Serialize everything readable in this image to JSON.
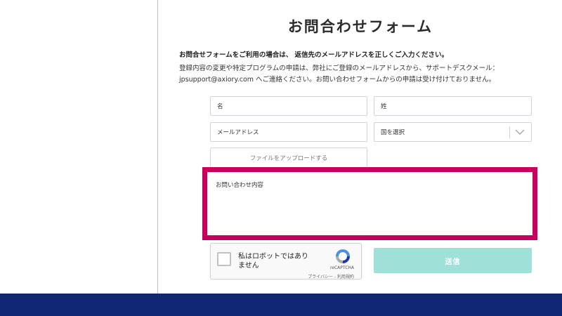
{
  "form": {
    "title": "お問合わせフォーム",
    "notice": "お問合せフォームをご利用の場合は、 返信先のメールアドレスを正しくご入力ください。",
    "description": "登録内容の変更や特定プログラムの申請は、弊社にご登録のメールアドレスから、サポートデスクメール：jpsupport@axiory.com へご連絡ください。お問い合わせフォームからの申請は受け付けておりません。",
    "first_name_placeholder": "名",
    "last_name_placeholder": "姓",
    "email_placeholder": "メールアドレス",
    "country_placeholder": "国を選択",
    "upload_label": "ファイルをアップロードする",
    "message_placeholder": "お問い合わせ内容",
    "submit_label": "送信"
  },
  "captcha": {
    "label": "私はロボットではありません",
    "brand": "reCAPTCHA",
    "links": "プライバシー - 利用規約"
  },
  "colors": {
    "highlight": "#c6005c",
    "submit": "#9fe1d8",
    "bottom_bar": "#102773"
  }
}
